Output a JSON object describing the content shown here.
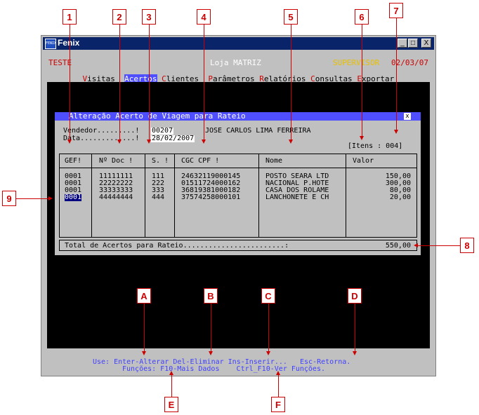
{
  "callouts": {
    "c1": "1",
    "c2": "2",
    "c3": "3",
    "c4": "4",
    "c5": "5",
    "c6": "6",
    "c7": "7",
    "c8": "8",
    "c9": "9",
    "cA": "A",
    "cB": "B",
    "cC": "C",
    "cD": "D",
    "cE": "E",
    "cF": "F"
  },
  "window": {
    "title": "Fenix",
    "icon_text": "FENIX",
    "min_label": "_",
    "max_label": "□",
    "close_label": "X"
  },
  "header": {
    "env": "TESTE",
    "store": "Loja MATRIZ",
    "user": "SUPERVISOR",
    "date": "02/03/07"
  },
  "menu": {
    "items": [
      {
        "hot": "V",
        "rest": "isitas"
      },
      {
        "hot": "A",
        "rest": "certos"
      },
      {
        "hot": "C",
        "rest": "lientes"
      },
      {
        "hot": "P",
        "rest": "arâmetros"
      },
      {
        "hot": "R",
        "rest": "elatórios"
      },
      {
        "hot": "C",
        "rest": "onsultas"
      },
      {
        "hot": "E",
        "rest": "xportar"
      }
    ]
  },
  "dialog": {
    "title": "Alteração Acerto de Viagem para Rateio",
    "close": "x",
    "vendedor_label": "Vendedor.........!",
    "vendedor_code": "00207",
    "vendedor_name": "JOSE CARLOS LIMA FERREIRA",
    "data_label": "Data.............!",
    "data_value": "28/02/2007",
    "itens": "[Itens : 004]",
    "columns": [
      "GEF!",
      "Nº Doc !",
      "S. !",
      "CGC CPF !",
      "Nome",
      "Valor"
    ],
    "rows": [
      {
        "gef": "0001",
        "doc": "11111111",
        "s": "111",
        "cgc": "24632119000145",
        "nome": "POSTO SEARA LTD",
        "valor": "150,00"
      },
      {
        "gef": "0001",
        "doc": "22222222",
        "s": "222",
        "cgc": "01511724000162",
        "nome": "NACIONAL P.HOTE",
        "valor": "300,00"
      },
      {
        "gef": "0001",
        "doc": "33333333",
        "s": "333",
        "cgc": "36819381000182",
        "nome": "CASA DOS ROLAME",
        "valor": "80,00"
      },
      {
        "gef": "0001",
        "doc": "44444444",
        "s": "444",
        "cgc": "37574258000101",
        "nome": "LANCHONETE E CH",
        "valor": "20,00"
      }
    ],
    "total_label": "Total de Acertos para Rateio........................:",
    "total_value": "550,00"
  },
  "footer": {
    "line1": "Use: Enter-Alterar Del-Eliminar Ins-Inserir...   Esc-Retorna.",
    "line2": "Funções: F10-Mais Dados    Ctrl_F10-Ver Funções."
  },
  "colors": {
    "titlebar": "#0a246a",
    "dialog_title": "#4f4fff",
    "menu_hot": "#cc0000",
    "menu_selected": "#4f4fff",
    "user": "#e8c000",
    "footer": "#4040ff",
    "callout": "#cc0000"
  }
}
